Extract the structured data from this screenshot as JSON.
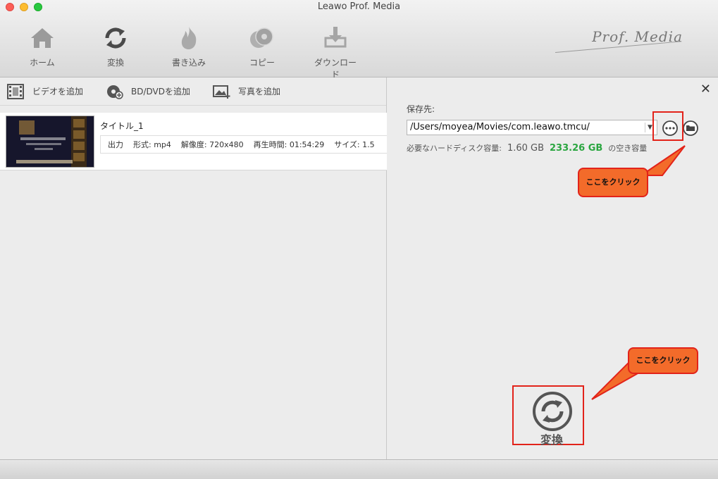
{
  "window": {
    "title": "Leawo Prof. Media",
    "brand": "Prof. Media"
  },
  "toolbar": {
    "items": [
      {
        "label": "ホーム",
        "icon": "home-icon"
      },
      {
        "label": "変換",
        "icon": "convert-icon"
      },
      {
        "label": "書き込み",
        "icon": "burn-icon"
      },
      {
        "label": "コピー",
        "icon": "copy-disc-icon"
      },
      {
        "label": "ダウンロード",
        "icon": "download-icon"
      }
    ]
  },
  "add_bar": {
    "add_video": "ビデオを追加",
    "add_bd_dvd": "BD/DVDを追加",
    "add_photo": "写真を追加"
  },
  "file_item": {
    "title": "タイトル_1",
    "output_label": "出力",
    "format": "形式: mp4",
    "resolution": "解像度:  720x480",
    "duration": "再生時間:  01:54:29",
    "size": "サイズ:  1.5"
  },
  "save_panel": {
    "label": "保存先:",
    "path": "/Users/moyea/Movies/com.leawo.tmcu/",
    "disk_required_label": "必要なハードディスク容量:",
    "disk_required": "1.60 GB",
    "disk_free": "233.26 GB",
    "disk_free_suffix": "の空き容量"
  },
  "callouts": {
    "top": "ここをクリック",
    "bottom": "ここをクリック"
  },
  "convert": {
    "label": "変換"
  },
  "colors": {
    "highlight": "#e2231a",
    "callout": "#f36b2a",
    "free_space": "#2aa640"
  }
}
